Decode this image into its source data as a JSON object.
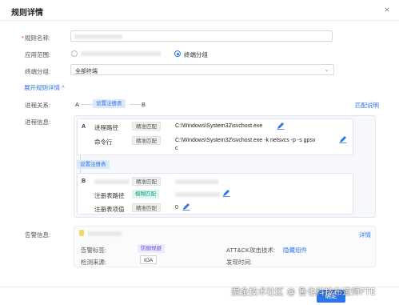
{
  "modal": {
    "title": "规则详情",
    "close_glyph": "×"
  },
  "form": {
    "rule_name_label": "规则名称:",
    "scope_label": "应用范围:",
    "scope_option_selected": "终端分组",
    "group_label": "终端分组:",
    "group_value": "全部终端",
    "expand_link": "展开规则详情",
    "relation_label": "进程关系:",
    "relation_a": "A",
    "relation_tag": "设置注册表",
    "relation_b": "B",
    "match_link": "匹配说明",
    "info_label": "进程信息:"
  },
  "process_a": {
    "letter": "A",
    "rows": [
      {
        "key": "进程路径",
        "match": "精准匹配",
        "value": "C:\\Windows\\System32\\svchost.exe"
      },
      {
        "key": "命令行",
        "match": "精准匹配",
        "value": "C:\\Windows\\System32\\svchost.exe -k netsvcs -p -s gpsv",
        "value_cont": "c"
      }
    ]
  },
  "connector_tag": "设置注册表",
  "process_b": {
    "letter": "B",
    "rows": [
      {
        "key": "",
        "match": "精准匹配",
        "value": ""
      },
      {
        "key": "注册表路径",
        "match": "模糊匹配",
        "value": ""
      },
      {
        "key": "注册表项值",
        "match": "精准匹配",
        "value": "0"
      }
    ]
  },
  "alert": {
    "label": "告警信息:",
    "detail_link": "详情",
    "tags_label": "告警标签:",
    "tags_value": "防御规避",
    "attck_label": "ATT&CK攻击技术:",
    "attck_value": "隐藏组件",
    "source_label": "检测来源:",
    "source_value": "IOA",
    "time_label": "发现时间:"
  },
  "footer": {
    "ok_label": "确定"
  },
  "watermark": "掘金技术社区 @ 鲁也科技布道师FTE",
  "colors": {
    "accent": "#2f74e8",
    "teal": "#17a58a",
    "purple": "#6d4dd6"
  }
}
